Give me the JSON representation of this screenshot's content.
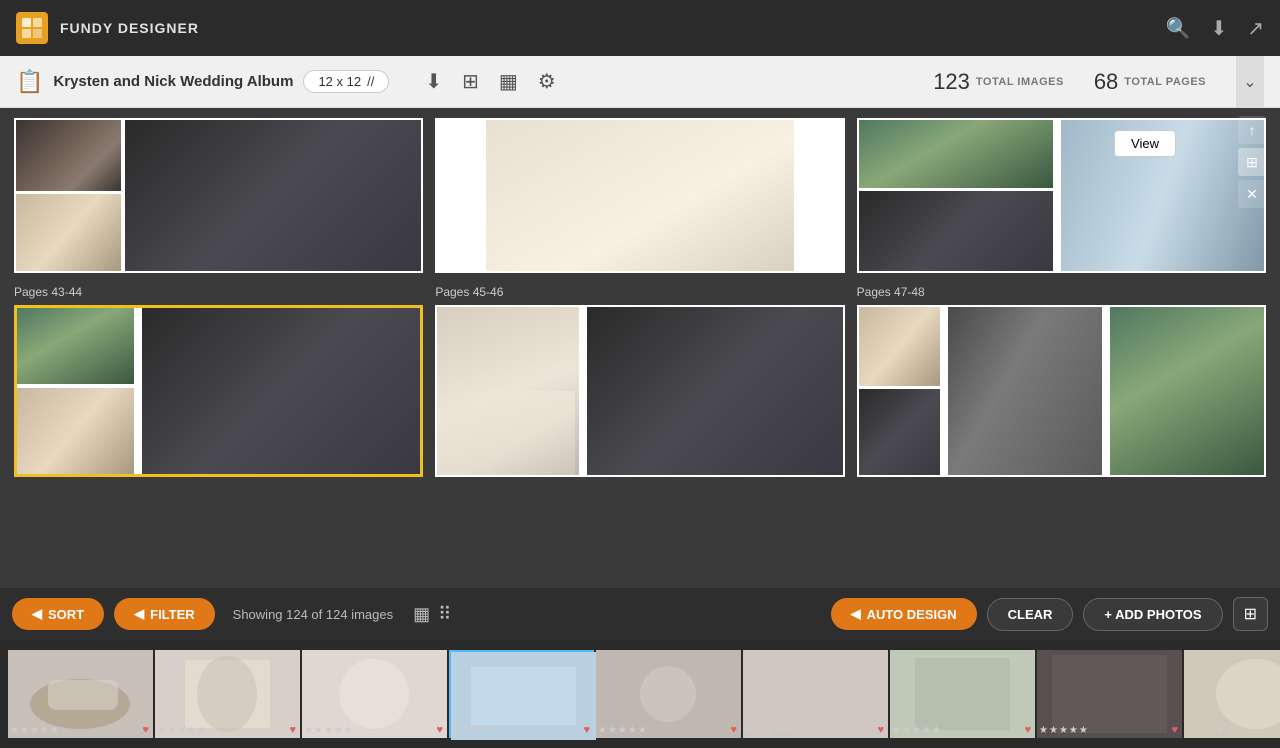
{
  "app": {
    "name": "FUNDY DESIGNER"
  },
  "topbar": {
    "title": "FUNDY DESIGNER",
    "icons": [
      "search",
      "download",
      "export"
    ]
  },
  "toolbar": {
    "project_name": "Krysten and Nick Wedding Album",
    "size": "12 x 12",
    "size_suffix": "//",
    "total_images_count": "123",
    "total_images_label": "TOTAL IMAGES",
    "total_pages_count": "68",
    "total_pages_label": "TOTAL PAGES"
  },
  "album": {
    "spreads": [
      {
        "pages": "Pages 43-44",
        "selected": true
      },
      {
        "pages": "Pages 45-46",
        "selected": false
      },
      {
        "pages": "Pages 47-48",
        "selected": false
      }
    ],
    "view_button": "View"
  },
  "bottom_toolbar": {
    "sort_label": "SORT",
    "filter_label": "FILTER",
    "showing_text": "Showing 124 of 124 images",
    "auto_design_label": "AUTO DESIGN",
    "clear_label": "CLEAR",
    "add_photos_label": "+ ADD PHOTOS"
  },
  "photos": [
    {
      "id": 1,
      "color_class": "photo-color-1",
      "selected": false
    },
    {
      "id": 2,
      "color_class": "photo-color-2",
      "selected": false
    },
    {
      "id": 3,
      "color_class": "photo-color-3",
      "selected": false
    },
    {
      "id": 4,
      "color_class": "photo-color-4",
      "selected": true
    },
    {
      "id": 5,
      "color_class": "photo-color-5",
      "selected": false
    },
    {
      "id": 6,
      "color_class": "photo-color-6",
      "selected": false
    },
    {
      "id": 7,
      "color_class": "photo-color-7",
      "selected": false
    },
    {
      "id": 8,
      "color_class": "photo-color-8",
      "selected": false
    },
    {
      "id": 9,
      "color_class": "photo-color-9",
      "selected": false
    }
  ]
}
